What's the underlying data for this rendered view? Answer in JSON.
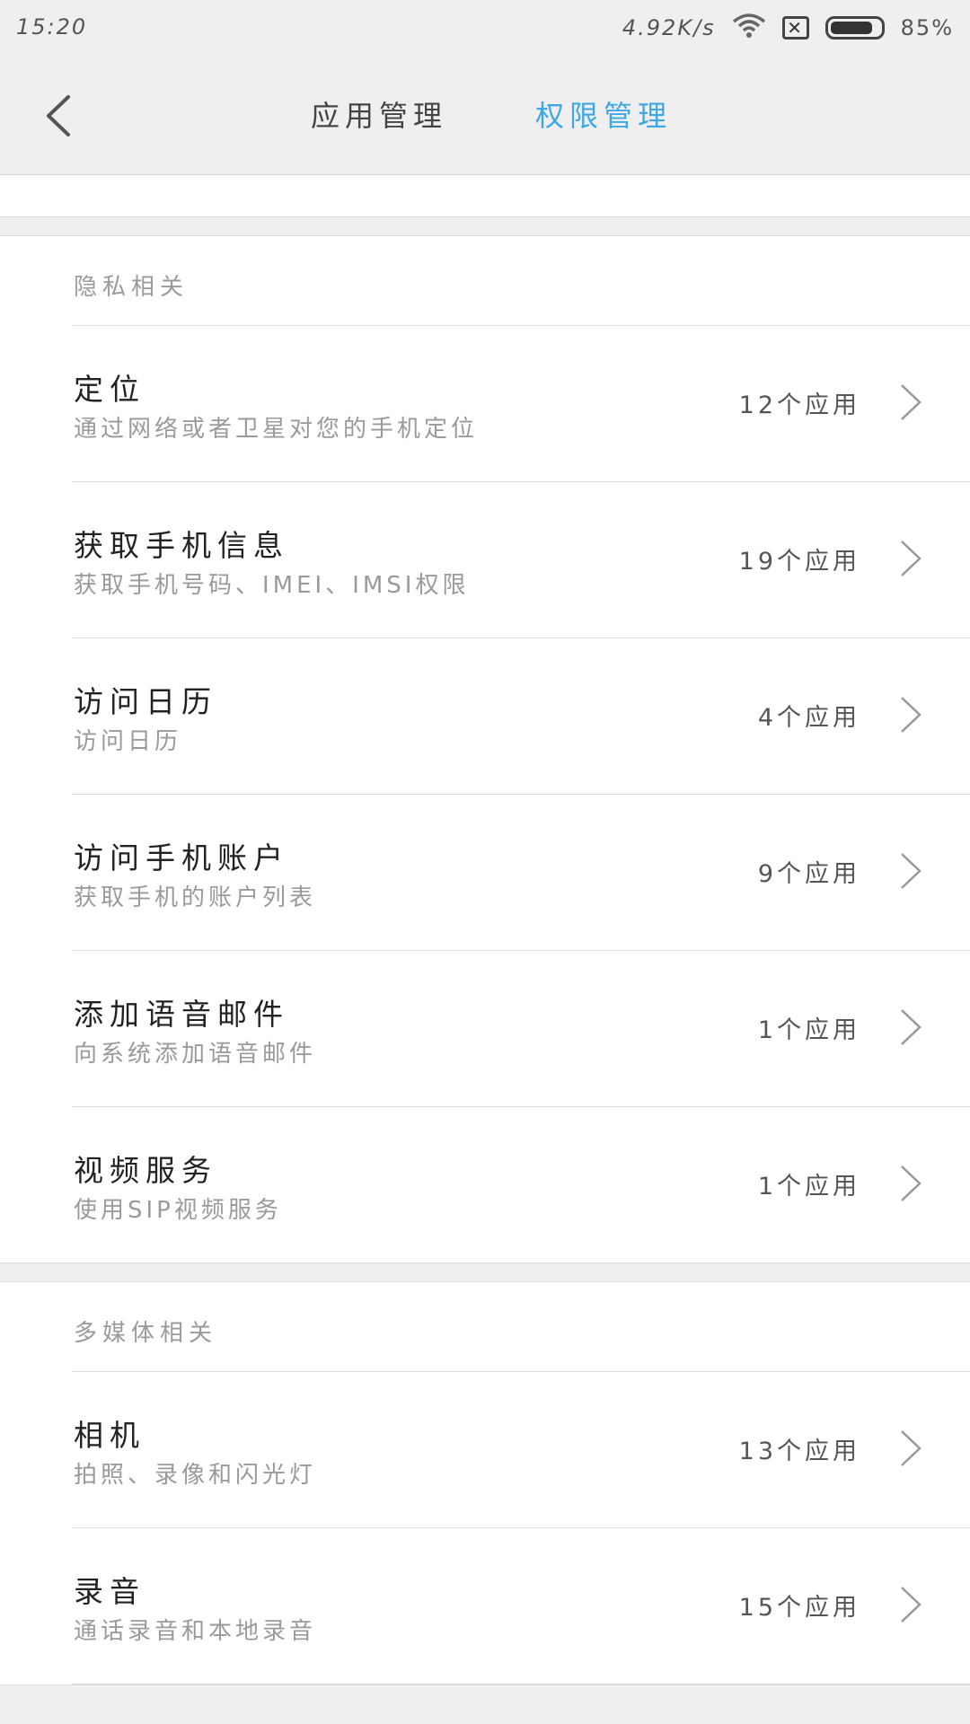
{
  "status_bar": {
    "time": "15:20",
    "net_speed": "4.92K/s",
    "battery_percent_text": "85%",
    "battery_level": 0.85,
    "sim_icon_glyph": "✕",
    "wifi_icon": "wifi-icon",
    "sim_icon": "no-sim-icon",
    "battery_icon": "battery-icon"
  },
  "header": {
    "back_icon": "back-arrow-icon",
    "tabs": [
      {
        "label": "应用管理",
        "active": false
      },
      {
        "label": "权限管理",
        "active": true
      }
    ],
    "accent_color": "#3ea8e6"
  },
  "sections": [
    {
      "header": "隐私相关",
      "rows": [
        {
          "title": "定位",
          "subtitle": "通过网络或者卫星对您的手机定位",
          "count": "12个应用"
        },
        {
          "title": "获取手机信息",
          "subtitle": "获取手机号码、IMEI、IMSI权限",
          "count": "19个应用"
        },
        {
          "title": "访问日历",
          "subtitle": "访问日历",
          "count": "4个应用"
        },
        {
          "title": "访问手机账户",
          "subtitle": "获取手机的账户列表",
          "count": "9个应用"
        },
        {
          "title": "添加语音邮件",
          "subtitle": "向系统添加语音邮件",
          "count": "1个应用"
        },
        {
          "title": "视频服务",
          "subtitle": "使用SIP视频服务",
          "count": "1个应用"
        }
      ]
    },
    {
      "header": "多媒体相关",
      "rows": [
        {
          "title": "相机",
          "subtitle": "拍照、录像和闪光灯",
          "count": "13个应用"
        },
        {
          "title": "录音",
          "subtitle": "通话录音和本地录音",
          "count": "15个应用"
        }
      ]
    }
  ]
}
